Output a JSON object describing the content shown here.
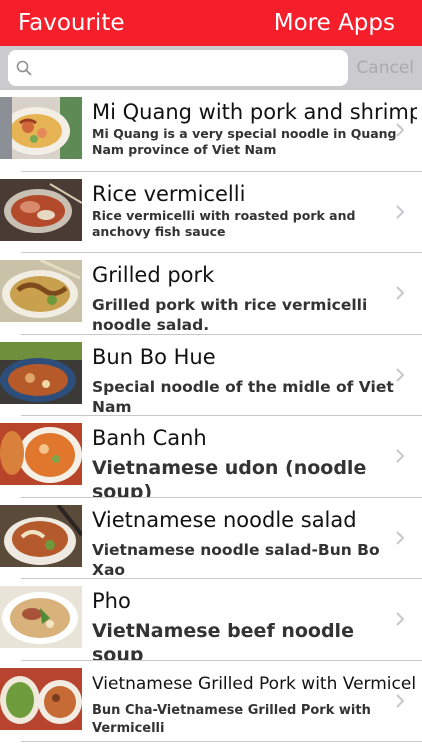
{
  "navbar": {
    "left_label": "Favourite",
    "right_label": "More Apps",
    "color": "#f41f2b"
  },
  "search": {
    "placeholder": "",
    "value": "",
    "cancel_label": "Cancel"
  },
  "list": {
    "items": [
      {
        "title": "Mi Quang with pork and shrimp",
        "subtitle": "Mi Quang is a very special noodle in Quang Nam province of Viet Nam",
        "image": "mi-quang-photo"
      },
      {
        "title": "Rice vermicelli",
        "subtitle": "Rice vermicelli with roasted pork and anchovy fish sauce",
        "image": "rice-vermicelli-photo"
      },
      {
        "title": "Grilled pork",
        "subtitle": "Grilled pork with rice vermicelli noodle salad.",
        "image": "grilled-pork-photo"
      },
      {
        "title": "Bun Bo Hue",
        "subtitle": "Special noodle of the midle of Viet Nam",
        "image": "bun-bo-hue-photo"
      },
      {
        "title": "Banh Canh",
        "subtitle": "Vietnamese udon (noodle soup)",
        "image": "banh-canh-photo"
      },
      {
        "title": "Vietnamese noodle salad",
        "subtitle": "Vietnamese noodle salad-Bun Bo Xao",
        "image": "noodle-salad-photo"
      },
      {
        "title": "Pho",
        "subtitle": " VietNamese beef noodle soup",
        "image": "pho-photo"
      },
      {
        "title": "Vietnamese Grilled Pork with Vermicelli",
        "subtitle": "Bun Cha-Vietnamese Grilled Pork with Vermicelli",
        "image": "bun-cha-photo"
      }
    ]
  }
}
